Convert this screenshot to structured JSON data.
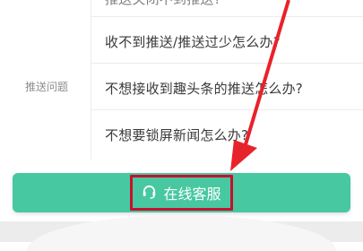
{
  "faq": {
    "category": "推送问题",
    "questions": [
      {
        "text": "推送关闭不到推送?"
      },
      {
        "text": "收不到推送/推送过少怎么办?"
      },
      {
        "text": "不想接收到趣头条的推送怎么办?"
      },
      {
        "text": "不想要锁屏新闻怎么办?"
      }
    ]
  },
  "service": {
    "label": "在线客服",
    "icon": "headset-icon"
  },
  "annotation": {
    "arrow_color": "#e8222b",
    "highlight_color": "#c8102e"
  },
  "colors": {
    "button": "#47c8a1",
    "text": "#3a3a3a",
    "category_text": "#8e8e8e"
  }
}
